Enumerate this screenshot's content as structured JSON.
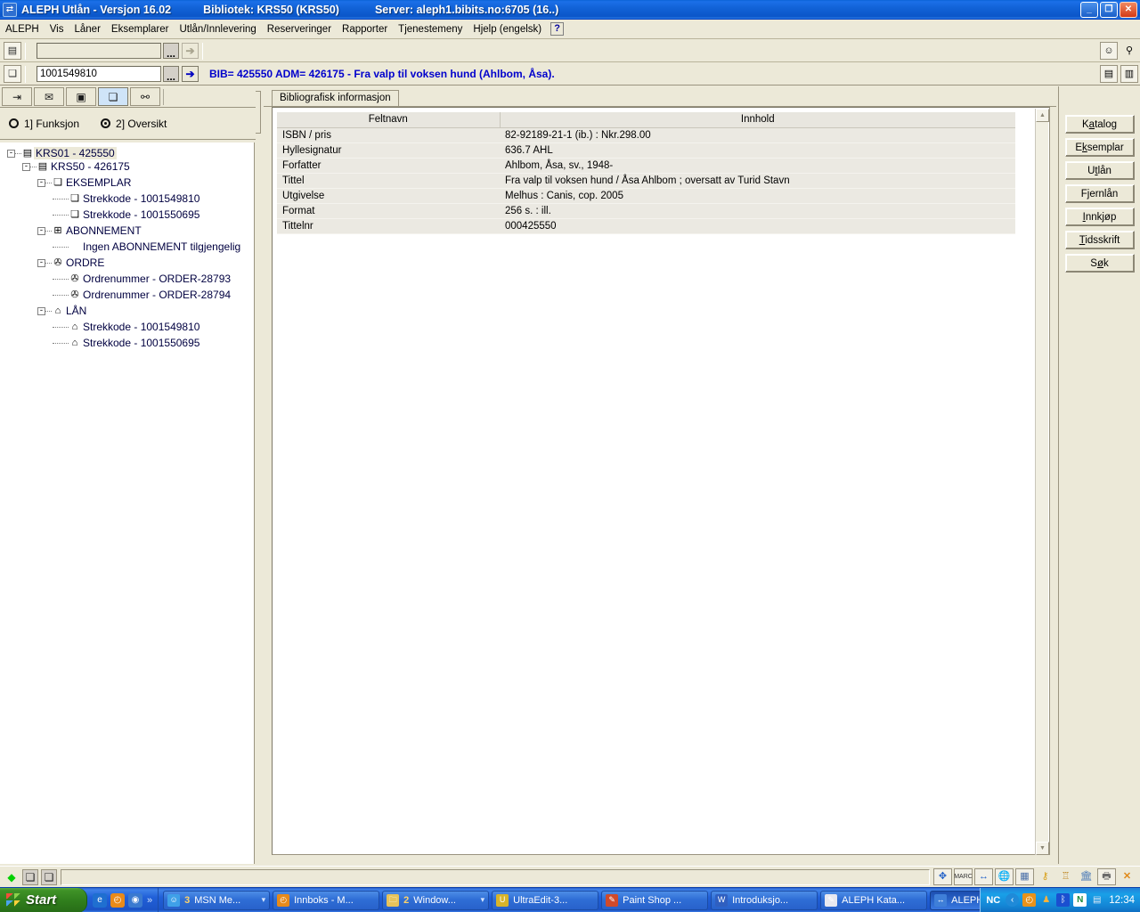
{
  "window": {
    "app_icon": "aleph-icon",
    "title": "ALEPH Utlån - Versjon 16.02",
    "library_label": "Bibliotek:",
    "library_value": "KRS50 (KRS50)",
    "server_label": "Server:",
    "server_value": "aleph1.bibits.no:6705 (16..)",
    "minimize": "_",
    "restore": "❐",
    "close": "✕"
  },
  "menubar": {
    "items": [
      "ALEPH",
      "Vis",
      "Låner",
      "Eksemplarer",
      "Utlån/Innlevering",
      "Reserveringer",
      "Rapporter",
      "Tjenestemeny",
      "Hjelp (engelsk)"
    ],
    "help_button": "?"
  },
  "toolbar": {
    "row1": {
      "icon": "patron-card-icon",
      "input_value": "",
      "input_placeholder": "",
      "browse_button": "...",
      "go_button": "➔"
    },
    "row2": {
      "icon": "item-cube-icon",
      "input_value": "1001549810",
      "input_placeholder": "",
      "browse_button": "...",
      "go_button": "➔",
      "bib_info": "BIB= 425550 ADM= 426175 - Fra valp til voksen hund (Ahlbom, Åsa)."
    },
    "right_icons": [
      "patron-search-icon",
      "balloon-icon",
      "save-icon",
      "list-icon"
    ]
  },
  "sidebar": {
    "tabs": [
      {
        "name": "circulation-tab",
        "glyph": "⇥"
      },
      {
        "name": "mail-tab",
        "glyph": "✉"
      },
      {
        "name": "patron-tab",
        "glyph": "▣"
      },
      {
        "name": "items-tab",
        "glyph": "❏"
      },
      {
        "name": "search-tab",
        "glyph": "🔍"
      }
    ],
    "active_tab_index": 3,
    "radios": [
      {
        "label": "1] Funksjon",
        "selected": false
      },
      {
        "label": "2] Oversikt",
        "selected": true
      }
    ],
    "tree": [
      {
        "level": 0,
        "toggle": "-",
        "icon": "record-icon",
        "label": "KRS01 - 425550",
        "selected": true
      },
      {
        "level": 1,
        "toggle": "-",
        "icon": "record-icon",
        "label": "KRS50 - 426175",
        "selected": false
      },
      {
        "level": 2,
        "toggle": "-",
        "icon": "cube-icon",
        "label": "EKSEMPLAR",
        "selected": false
      },
      {
        "level": 3,
        "toggle": "",
        "icon": "cube-icon",
        "label": "Strekkode - 1001549810",
        "selected": false
      },
      {
        "level": 3,
        "toggle": "",
        "icon": "cube-icon",
        "label": "Strekkode - 1001550695",
        "selected": false
      },
      {
        "level": 2,
        "toggle": "-",
        "icon": "subscription-icon",
        "label": "ABONNEMENT",
        "selected": false
      },
      {
        "level": 3,
        "toggle": "",
        "icon": "none",
        "label": "Ingen ABONNEMENT tilgjengelig",
        "selected": false
      },
      {
        "level": 2,
        "toggle": "-",
        "icon": "order-icon",
        "label": "ORDRE",
        "selected": false
      },
      {
        "level": 3,
        "toggle": "",
        "icon": "order-icon",
        "label": "Ordrenummer - ORDER-28793",
        "selected": false
      },
      {
        "level": 3,
        "toggle": "",
        "icon": "order-icon",
        "label": "Ordrenummer - ORDER-28794",
        "selected": false
      },
      {
        "level": 2,
        "toggle": "-",
        "icon": "loan-icon",
        "label": "LÅN",
        "selected": false
      },
      {
        "level": 3,
        "toggle": "",
        "icon": "loan-icon",
        "label": "Strekkode - 1001549810",
        "selected": false
      },
      {
        "level": 3,
        "toggle": "",
        "icon": "loan-icon",
        "label": "Strekkode - 1001550695",
        "selected": false
      }
    ]
  },
  "main": {
    "tab_label": "Bibliografisk informasjon",
    "table": {
      "headers": [
        "Feltnavn",
        "Innhold"
      ],
      "rows": [
        {
          "field": "ISBN / pris",
          "value": "82-92189-21-1 (ib.) : Nkr.298.00"
        },
        {
          "field": "Hyllesignatur",
          "value": "636.7 AHL"
        },
        {
          "field": "Forfatter",
          "value": "Ahlbom, Åsa, sv., 1948-"
        },
        {
          "field": "Tittel",
          "value": "Fra valp til voksen hund / Åsa Ahlbom ; oversatt av Turid Stavn"
        },
        {
          "field": "Utgivelse",
          "value": "Melhus : Canis, cop. 2005"
        },
        {
          "field": "Format",
          "value": "256 s. : ill."
        },
        {
          "field": "Tittelnr",
          "value": "000425550"
        }
      ]
    },
    "scroll_up": "▲",
    "scroll_down": "▼"
  },
  "right_buttons": [
    {
      "label": "Katalog",
      "accel_index": 1
    },
    {
      "label": "Eksemplar",
      "accel_index": 1
    },
    {
      "label": "Utlån",
      "accel_index": 1
    },
    {
      "label": "Fjernlån",
      "accel_index": 1
    },
    {
      "label": "Innkjøp",
      "accel_index": 0
    },
    {
      "label": "Tidsskrift",
      "accel_index": 0
    },
    {
      "label": "Søk",
      "accel_index": 1
    }
  ],
  "statusbar": {
    "left_icons": [
      "green-diamond-icon",
      "cube-icon",
      "cube-icon"
    ],
    "field_value": "",
    "right_icons": [
      "move-icon",
      "marc-icon",
      "exchange-icon",
      "globe-icon",
      "grid-icon",
      "key-icon",
      "tower-icon",
      "bank-icon",
      "print-icon",
      "close-x-icon"
    ]
  },
  "taskbar": {
    "start_label": "Start",
    "quicklaunch": [
      {
        "name": "internet-explorer-icon",
        "glyph": "e",
        "color": "#1f6fd0"
      },
      {
        "name": "clock-icon",
        "glyph": "◴",
        "color": "#e88a1a"
      },
      {
        "name": "media-icon",
        "glyph": "◉",
        "color": "#3a7ad0"
      }
    ],
    "quicklaunch_more": "»",
    "tasks": [
      {
        "name": "task-msn-messenger",
        "count": "3",
        "label": "MSN Me...",
        "icon_color": "#3fa0e8",
        "glyph": "☺",
        "has_chevron": true,
        "active": false
      },
      {
        "name": "task-innboks",
        "count": "",
        "label": "Innboks - M...",
        "icon_color": "#e88a1a",
        "glyph": "◴",
        "has_chevron": false,
        "active": false
      },
      {
        "name": "task-windows",
        "count": "2",
        "label": "Window...",
        "icon_color": "#e8c35a",
        "glyph": "🗀",
        "has_chevron": true,
        "active": false
      },
      {
        "name": "task-ultraedit",
        "count": "",
        "label": "UltraEdit-3...",
        "icon_color": "#d8b42a",
        "glyph": "U",
        "has_chevron": false,
        "active": false
      },
      {
        "name": "task-paint-shop",
        "count": "",
        "label": "Paint Shop ...",
        "icon_color": "#d04a2a",
        "glyph": "✎",
        "has_chevron": false,
        "active": false
      },
      {
        "name": "task-introduksjon",
        "count": "",
        "label": "Introduksjo...",
        "icon_color": "#2f5fc0",
        "glyph": "W",
        "has_chevron": false,
        "active": false
      },
      {
        "name": "task-aleph-katalog",
        "count": "",
        "label": "ALEPH Kata...",
        "icon_color": "#e8e8f0",
        "glyph": "✎",
        "has_chevron": false,
        "active": false
      },
      {
        "name": "task-aleph-utlan",
        "count": "",
        "label": "ALEPH Utlå...",
        "icon_color": "#3f7fd8",
        "glyph": "↔",
        "has_chevron": false,
        "active": true
      }
    ],
    "tray": {
      "nc_label": "NC",
      "icons": [
        {
          "name": "show-hidden-icon",
          "glyph": "‹",
          "color": "#1f8ad8"
        },
        {
          "name": "clock-tray-icon",
          "glyph": "◴",
          "color": "#e8921a"
        },
        {
          "name": "network-icon",
          "glyph": "♟",
          "color": "#d05a2a"
        },
        {
          "name": "bluetooth-icon",
          "glyph": "ᛒ",
          "color": "#1a4fd0"
        },
        {
          "name": "norton-icon",
          "glyph": "N",
          "color": "#1a8a3a"
        },
        {
          "name": "display-icon",
          "glyph": "▤",
          "color": "#c9d6e8"
        }
      ],
      "time": "12:34"
    }
  }
}
